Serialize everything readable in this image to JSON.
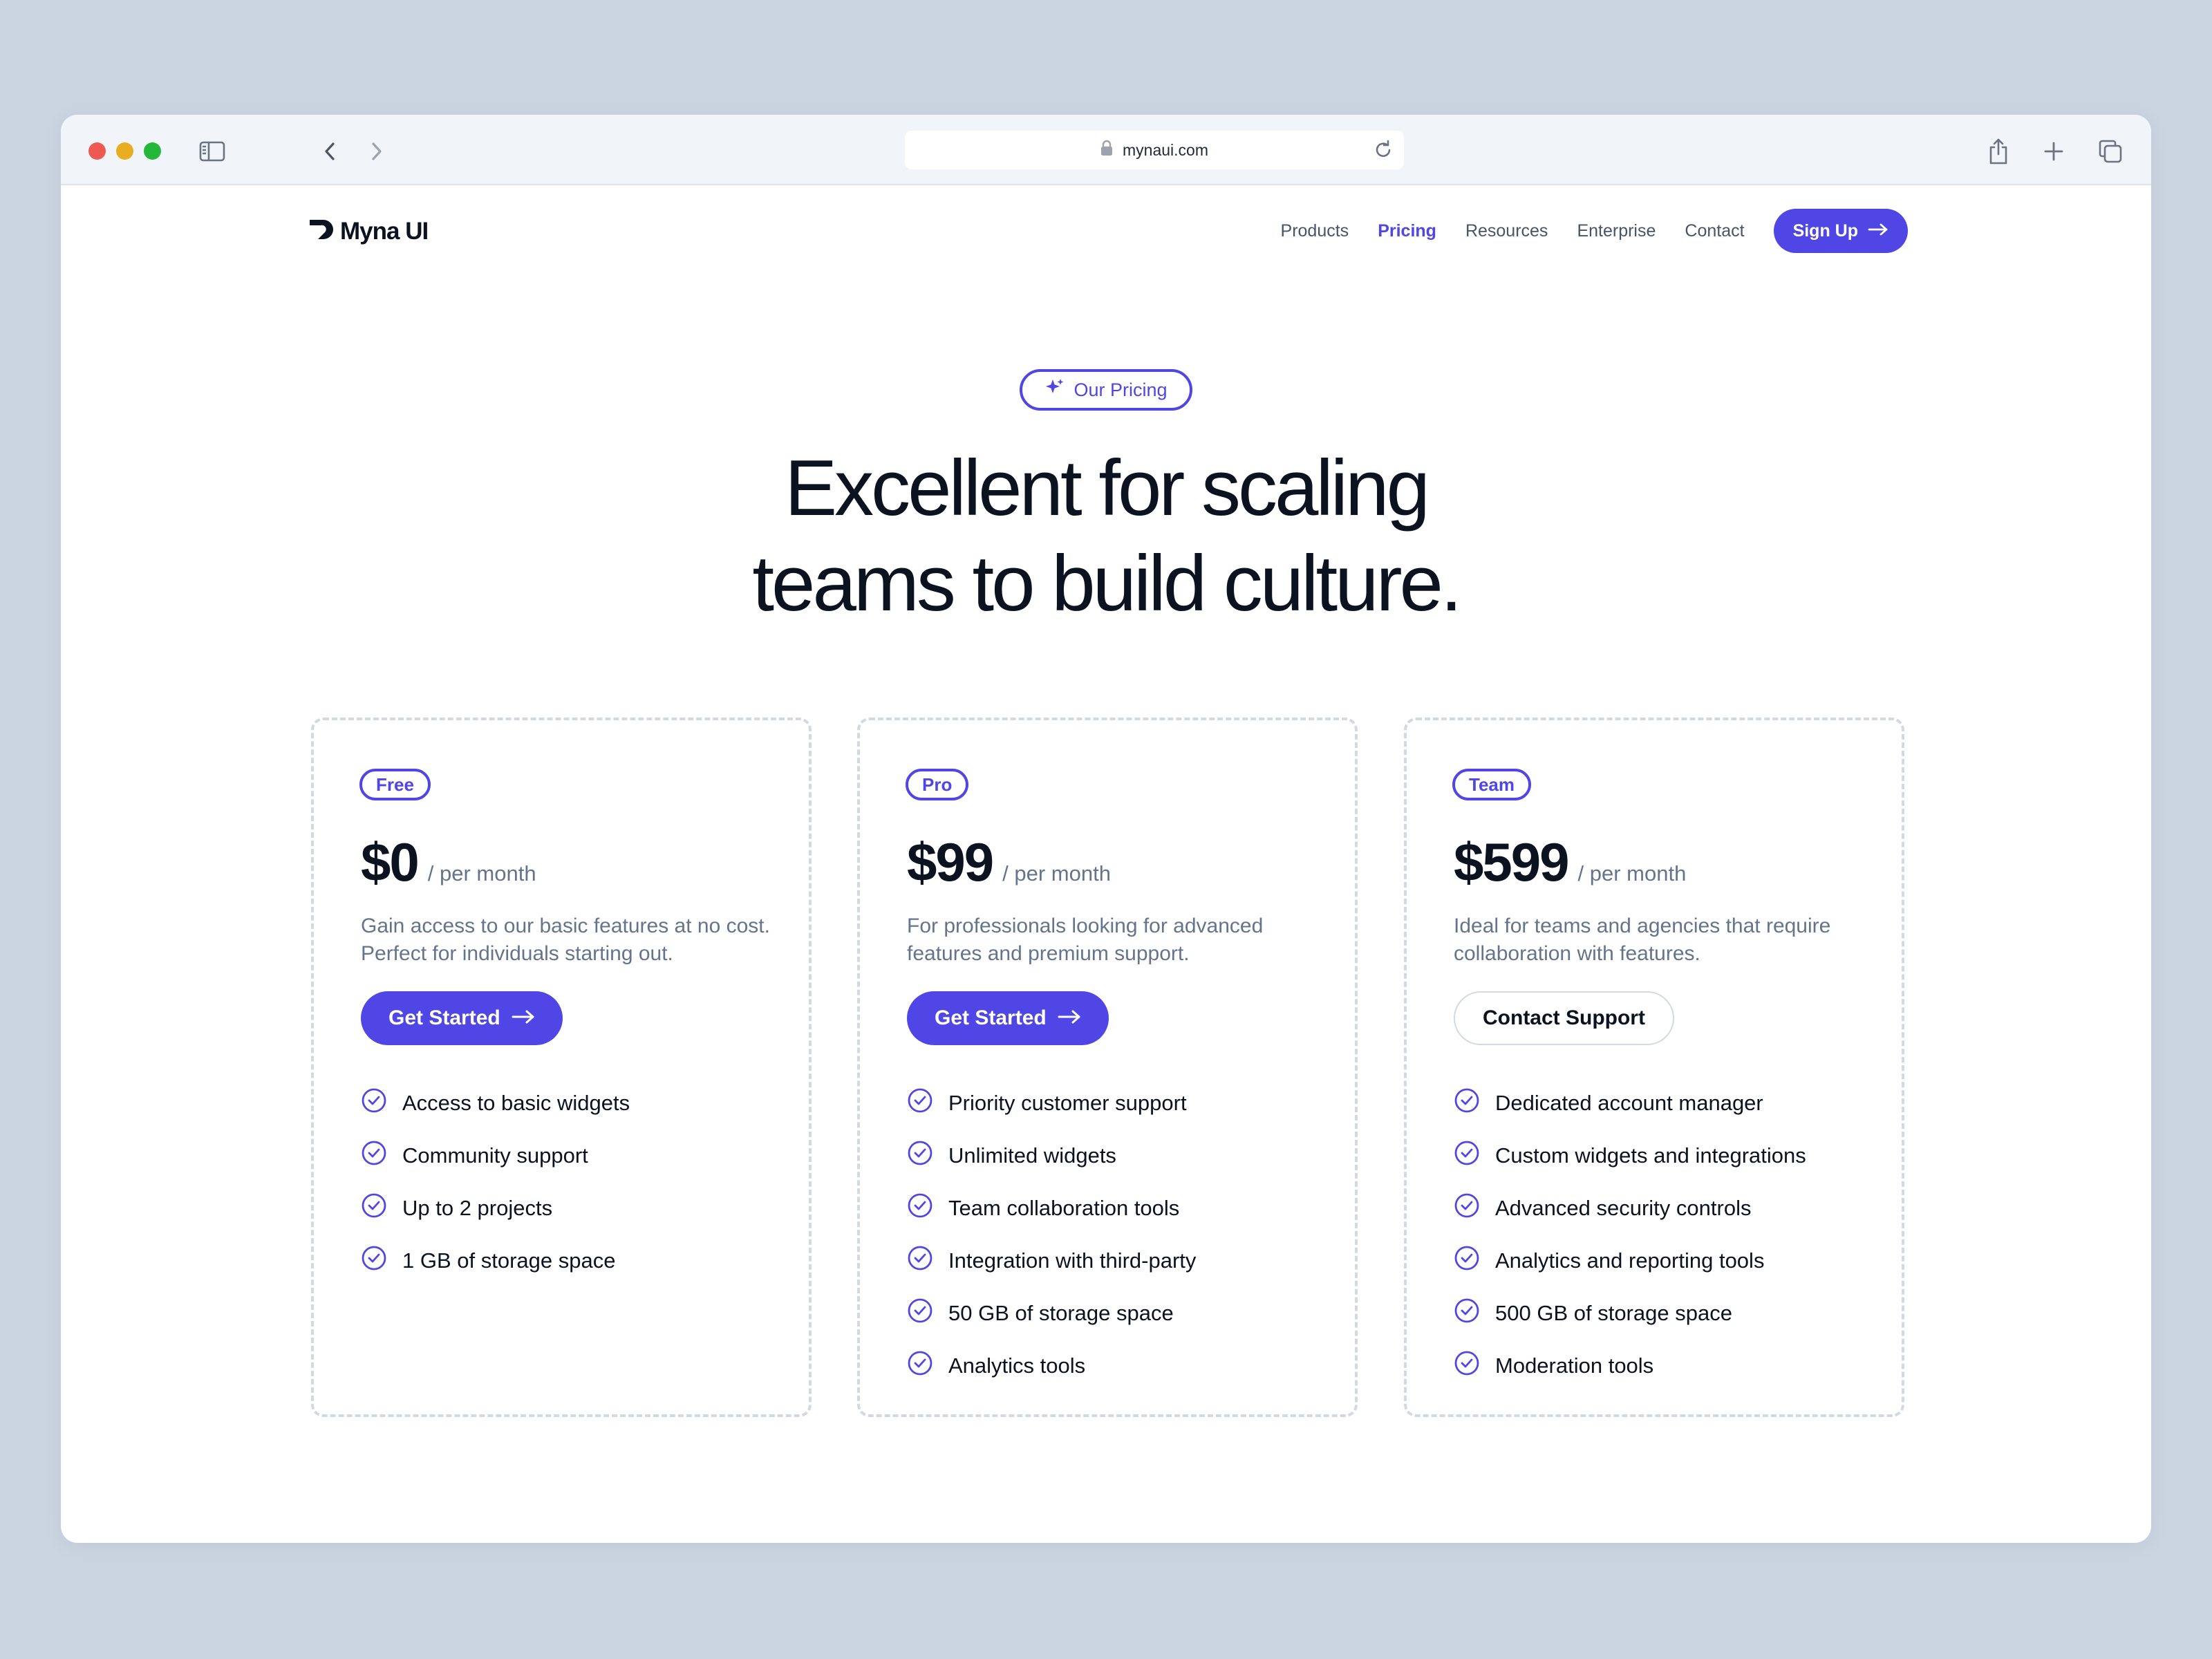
{
  "browser": {
    "url": "mynaui.com",
    "icons": [
      "sidebar-icon",
      "back-icon",
      "forward-icon",
      "lock-icon",
      "reload-icon",
      "share-icon",
      "new-tab-icon",
      "tabs-icon"
    ]
  },
  "brand": {
    "name": "Myna UI",
    "accent": "#4f46e5",
    "text": "#0b1220",
    "muted": "#64748b"
  },
  "nav": {
    "items": [
      {
        "label": "Products",
        "active": false
      },
      {
        "label": "Pricing",
        "active": true
      },
      {
        "label": "Resources",
        "active": false
      },
      {
        "label": "Enterprise",
        "active": false
      },
      {
        "label": "Contact",
        "active": false
      }
    ],
    "signup_label": "Sign Up"
  },
  "hero": {
    "badge": "Our Pricing",
    "headline_line1": "Excellent for scaling",
    "headline_line2": "teams to build culture."
  },
  "plans": [
    {
      "tier": "Free",
      "price": "$0",
      "period": "/ per month",
      "description": "Gain access to our basic features at no cost. Perfect for individuals starting out.",
      "cta": "Get Started",
      "features": [
        "Access to basic widgets",
        "Community support",
        "Up to 2 projects",
        "1 GB of storage space"
      ]
    },
    {
      "tier": "Pro",
      "price": "$99",
      "period": "/ per month",
      "description": "For professionals looking for advanced features and premium support.",
      "cta": "Get Started",
      "features": [
        "Priority customer support",
        "Unlimited widgets",
        "Team collaboration tools",
        "Integration with third-party",
        "50 GB of storage space",
        "Analytics tools"
      ]
    },
    {
      "tier": "Team",
      "price": "$599",
      "period": "/ per month",
      "description": "Ideal for teams and agencies that require collaboration with features.",
      "cta": "Contact Support",
      "features": [
        "Dedicated account manager",
        "Custom widgets and integrations",
        "Advanced security controls",
        "Analytics and reporting tools",
        "500 GB of storage space",
        "Moderation tools"
      ]
    }
  ]
}
